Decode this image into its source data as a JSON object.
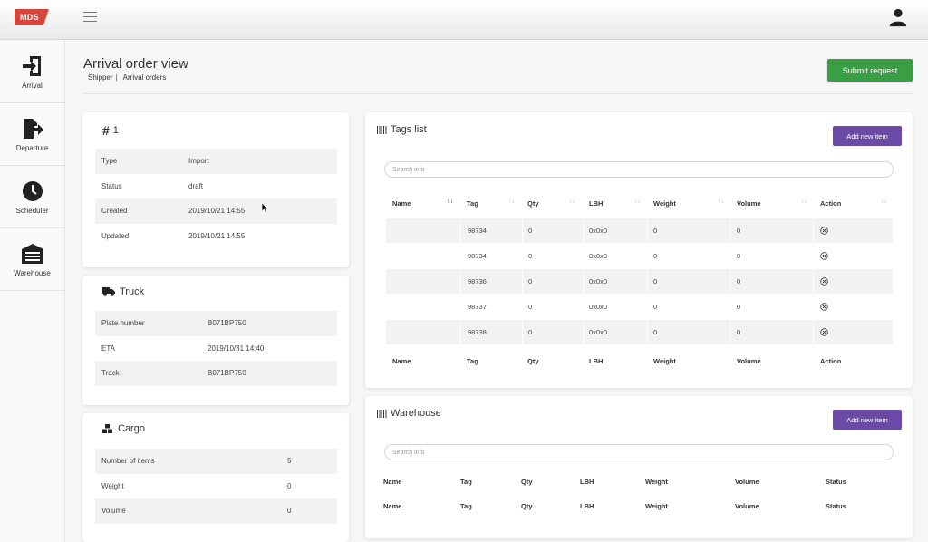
{
  "app": {
    "logo": "MDS"
  },
  "sidebar": {
    "items": [
      {
        "label": "Arrival",
        "icon": "arrival-icon"
      },
      {
        "label": "Departure",
        "icon": "departure-icon"
      },
      {
        "label": "Scheduler",
        "icon": "clock-icon"
      },
      {
        "label": "Warehouse",
        "icon": "warehouse-icon"
      }
    ]
  },
  "header": {
    "title": "Arrival order view",
    "breadcrumb": [
      "Shipper",
      "Arrival orders"
    ],
    "breadcrumb_sep": "|",
    "submit_label": "Submit request"
  },
  "order": {
    "title": "1",
    "rows": [
      {
        "label": "Type",
        "value": "Import"
      },
      {
        "label": "Status",
        "value": "draft"
      },
      {
        "label": "Created",
        "value": "2019/10/21 14:55"
      },
      {
        "label": "Updated",
        "value": "2019/10/21 14:55"
      }
    ]
  },
  "truck": {
    "title": "Truck",
    "rows": [
      {
        "label": "Plate number",
        "value": "B071BP750"
      },
      {
        "label": "ETA",
        "value": "2019/10/31 14:40"
      },
      {
        "label": "Track",
        "value": "B071BP750"
      }
    ]
  },
  "cargo": {
    "title": "Cargo",
    "rows": [
      {
        "label": "Number of items",
        "value": "5"
      },
      {
        "label": "Weight",
        "value": "0"
      },
      {
        "label": "Volume",
        "value": "0"
      }
    ]
  },
  "tags": {
    "title": "Tags list",
    "add_label": "Add new item",
    "search_placeholder": "Search info",
    "columns": [
      "Name",
      "Tag",
      "Qty",
      "LBH",
      "Weight",
      "Volume",
      "Action"
    ],
    "rows": [
      {
        "name": "",
        "tag": "98734",
        "qty": "0",
        "lbh": "0x0x0",
        "weight": "0",
        "volume": "0"
      },
      {
        "name": "",
        "tag": "98734",
        "qty": "0",
        "lbh": "0x0x0",
        "weight": "0",
        "volume": "0"
      },
      {
        "name": "",
        "tag": "98736",
        "qty": "0",
        "lbh": "0x0x0",
        "weight": "0",
        "volume": "0"
      },
      {
        "name": "",
        "tag": "98737",
        "qty": "0",
        "lbh": "0x0x0",
        "weight": "0",
        "volume": "0"
      },
      {
        "name": "",
        "tag": "98738",
        "qty": "0",
        "lbh": "0x0x0",
        "weight": "0",
        "volume": "0"
      }
    ]
  },
  "warehouse": {
    "title": "Warehouse",
    "add_label": "Add new item",
    "search_placeholder": "Search info",
    "columns": [
      "Name",
      "Tag",
      "Qty",
      "LBH",
      "Weight",
      "Volume",
      "Status"
    ]
  },
  "colors": {
    "logo": "#d7443a",
    "submit": "#3a9e44",
    "add": "#6b4aa6"
  }
}
